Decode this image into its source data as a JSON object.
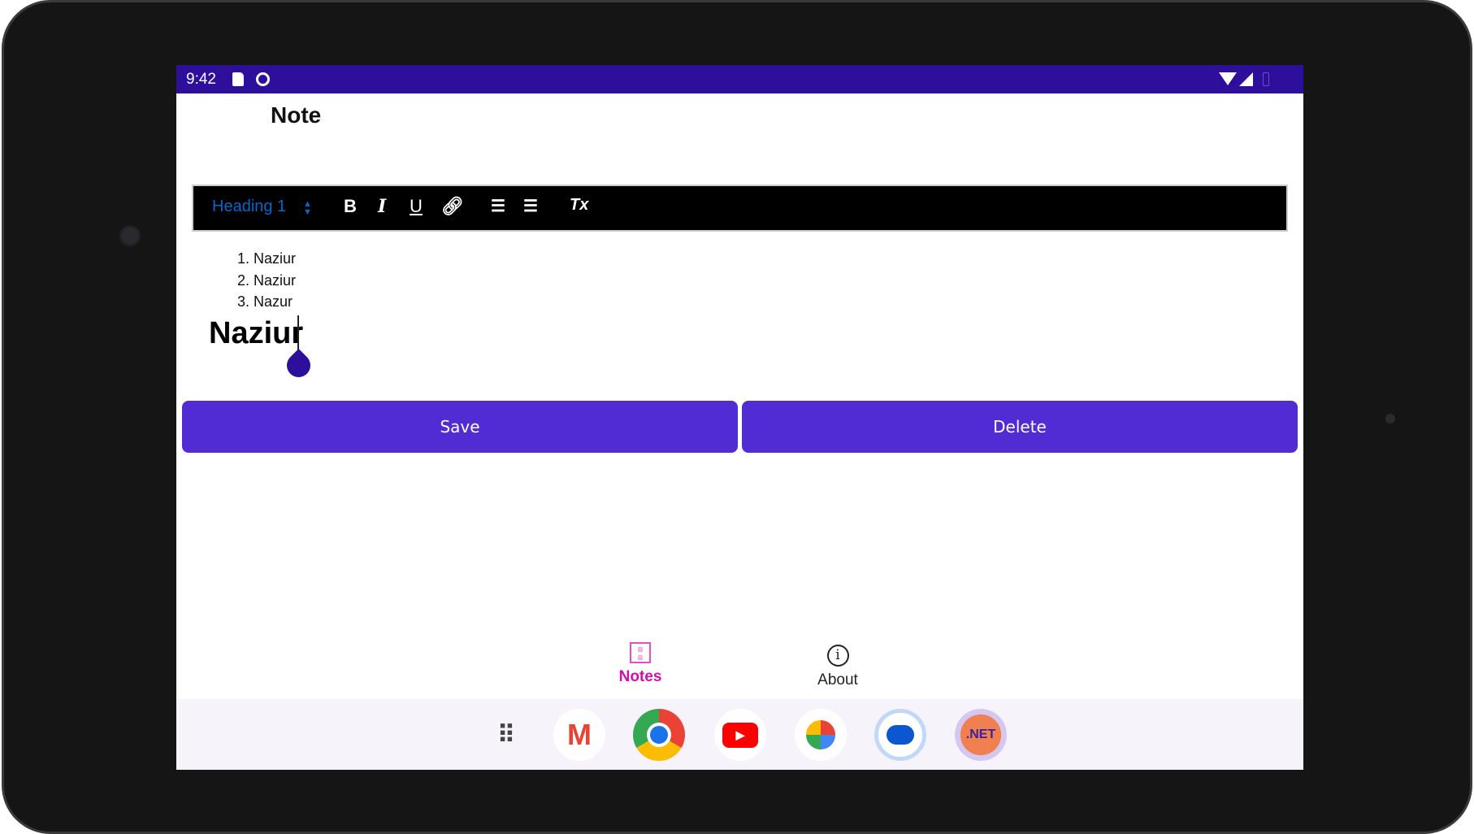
{
  "status_bar": {
    "time": "9:42"
  },
  "page": {
    "title": "Note"
  },
  "toolbar": {
    "heading_select": "Heading 1",
    "bold": "B",
    "italic": "I",
    "underline": "U",
    "clear": "Tx"
  },
  "editor": {
    "list_items": [
      "1. Naziur",
      "2. Naziur",
      "3. Nazur"
    ],
    "heading": "Naziur"
  },
  "buttons": {
    "save": "Save",
    "delete": "Delete"
  },
  "bottom_nav": {
    "items": [
      {
        "label": "Notes",
        "active": true,
        "color": "#d10fb0"
      },
      {
        "label": "About",
        "active": false
      }
    ]
  },
  "dock": {
    "apps": [
      "app-drawer",
      "gmail",
      "chrome",
      "youtube",
      "photos",
      "messages",
      "dotnet"
    ],
    "dotnet_label": ".NET"
  },
  "colors": {
    "status_bar": "#2e0f9c",
    "button": "#512bd4",
    "accent": "#0a66c8"
  }
}
